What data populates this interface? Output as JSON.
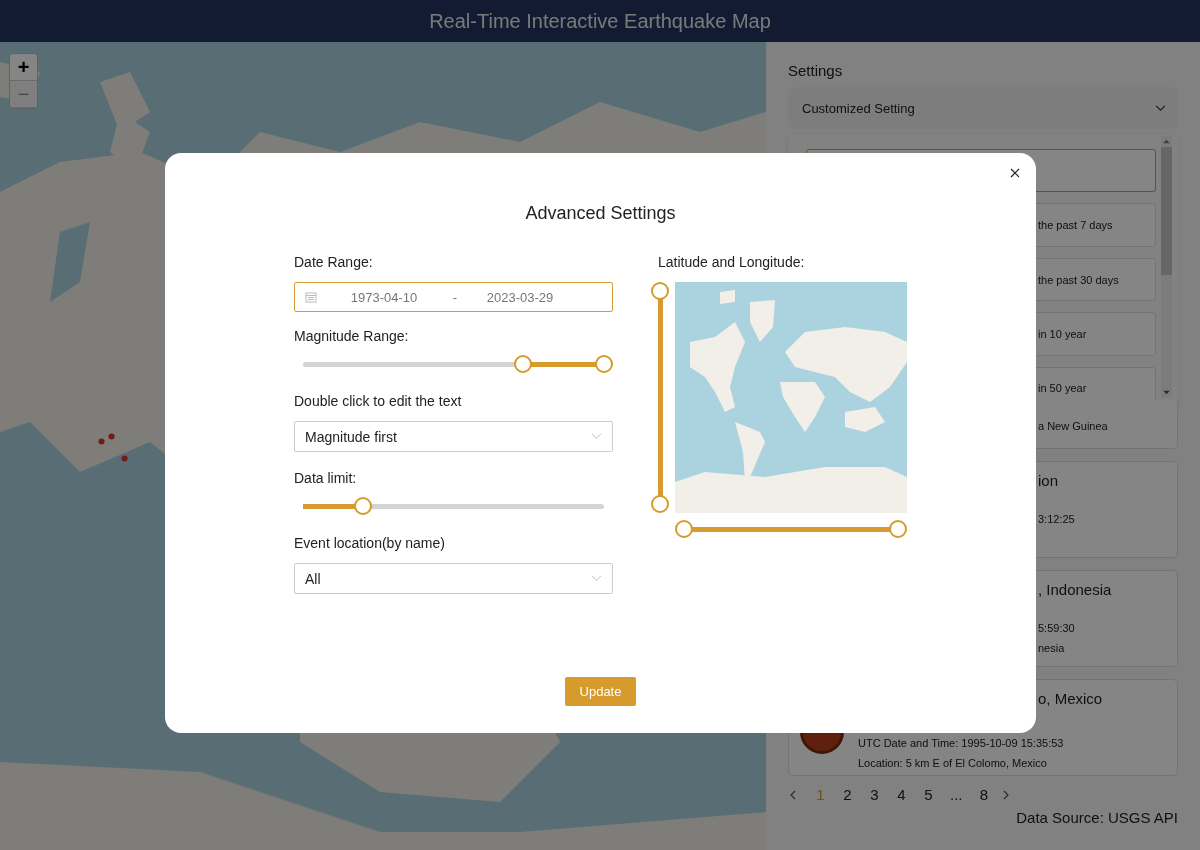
{
  "header": {
    "title": "Real-Time Interactive Earthquake Map"
  },
  "map": {
    "zoom_in": {
      "label": "+",
      "disabled": false
    },
    "zoom_out": {
      "label": "−",
      "disabled": true
    }
  },
  "sidebar": {
    "heading": "Settings",
    "mode_select": {
      "value": "Customized Setting"
    },
    "presets": [
      {
        "selected": true
      },
      {
        "label": "the past 7 days",
        "selected": false
      },
      {
        "label": "the past 30 days",
        "selected": false
      },
      {
        "label": "in 10 year",
        "selected": false
      },
      {
        "label": "in 50 year",
        "selected": false
      }
    ],
    "events": [
      {
        "location": "a New Guinea",
        "badge": false
      },
      {
        "title": "ion",
        "time": "3:12:25",
        "badge": false
      },
      {
        "title": ", Indonesia",
        "time": "5:59:30",
        "location": "nesia",
        "badge": false
      },
      {
        "title": "o, Mexico",
        "time": "UTC Date and Time: 1995-10-09 15:35:53",
        "location": "Location: 5 km E of El Colomo, Mexico",
        "badge": true
      }
    ],
    "pagination": {
      "pages": [
        {
          "label": "1",
          "selected": true
        },
        {
          "label": "2",
          "selected": false
        },
        {
          "label": "3",
          "selected": false
        },
        {
          "label": "4",
          "selected": false
        },
        {
          "label": "5",
          "selected": false
        },
        {
          "label": "...",
          "selected": false
        },
        {
          "label": "8",
          "selected": false
        }
      ]
    },
    "source": "Data Source: USGS API"
  },
  "modal": {
    "title": "Advanced Settings",
    "date_range": {
      "label": "Date Range:",
      "start": "1973-04-10",
      "separator": "-",
      "end": "2023-03-29",
      "focused": true
    },
    "magnitude_range": {
      "label": "Magnitude Range:",
      "thumbs": [
        {
          "level": 0.73
        },
        {
          "level": 1
        }
      ]
    },
    "sort": {
      "label": "Double click to edit the text",
      "value": "Magnitude first"
    },
    "data_limit": {
      "label": "Data limit:",
      "level": 0.2
    },
    "event_location": {
      "label": "Event location(by name)",
      "value": "All"
    },
    "lat_long": {
      "label": "Latitude and Longitude:",
      "latitude": [
        {
          "level": 1
        },
        {
          "level": 0
        }
      ],
      "longitude": [
        {
          "level": 0
        },
        {
          "level": 1
        }
      ]
    },
    "button": "Update"
  }
}
